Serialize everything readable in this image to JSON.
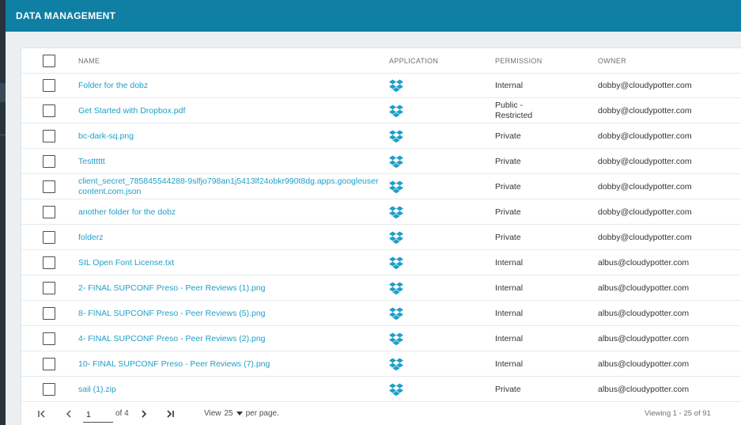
{
  "header": {
    "title": "DATA MANAGEMENT"
  },
  "columns": {
    "name": "NAME",
    "application": "APPLICATION",
    "permission": "PERMISSION",
    "owner": "OWNER"
  },
  "rows": [
    {
      "name": "Folder for the dobz",
      "application": "dropbox-icon",
      "permission": "Internal",
      "owner": "dobby@cloudypotter.com"
    },
    {
      "name": "Get Started with Dropbox.pdf",
      "application": "dropbox-icon",
      "permission": "Public - Restricted",
      "owner": "dobby@cloudypotter.com"
    },
    {
      "name": "bc-dark-sq.png",
      "application": "dropbox-icon",
      "permission": "Private",
      "owner": "dobby@cloudypotter.com"
    },
    {
      "name": "Testttttt",
      "application": "dropbox-icon",
      "permission": "Private",
      "owner": "dobby@cloudypotter.com"
    },
    {
      "name": "client_secret_785845544288-9slfjo798an1j5413lf24obkr990t8dg.apps.googleusercontent.com.json",
      "application": "dropbox-icon",
      "permission": "Private",
      "owner": "dobby@cloudypotter.com"
    },
    {
      "name": "another folder for the dobz",
      "application": "dropbox-icon",
      "permission": "Private",
      "owner": "dobby@cloudypotter.com"
    },
    {
      "name": "folderz",
      "application": "dropbox-icon",
      "permission": "Private",
      "owner": "dobby@cloudypotter.com"
    },
    {
      "name": "SIL Open Font License.txt",
      "application": "dropbox-icon",
      "permission": "Internal",
      "owner": "albus@cloudypotter.com"
    },
    {
      "name": "2- FINAL SUPCONF Preso - Peer Reviews (1).png",
      "application": "dropbox-icon",
      "permission": "Internal",
      "owner": "albus@cloudypotter.com"
    },
    {
      "name": "8- FINAL SUPCONF Preso - Peer Reviews (5).png",
      "application": "dropbox-icon",
      "permission": "Internal",
      "owner": "albus@cloudypotter.com"
    },
    {
      "name": "4- FINAL SUPCONF Preso - Peer Reviews (2).png",
      "application": "dropbox-icon",
      "permission": "Internal",
      "owner": "albus@cloudypotter.com"
    },
    {
      "name": "10- FINAL SUPCONF Preso - Peer Reviews (7).png",
      "application": "dropbox-icon",
      "permission": "Internal",
      "owner": "albus@cloudypotter.com"
    },
    {
      "name": "sail (1).zip",
      "application": "dropbox-icon",
      "permission": "Private",
      "owner": "albus@cloudypotter.com"
    }
  ],
  "pagination": {
    "page_value": "1",
    "of_total": "of 4",
    "view_label": "View",
    "view_value": "25",
    "per_page_label": "per page.",
    "viewing": "Viewing 1 - 25 of 91"
  },
  "colors": {
    "topbar": "#0f7fa3",
    "link": "#1e9fc9",
    "dropbox": "#1e9fc9"
  }
}
